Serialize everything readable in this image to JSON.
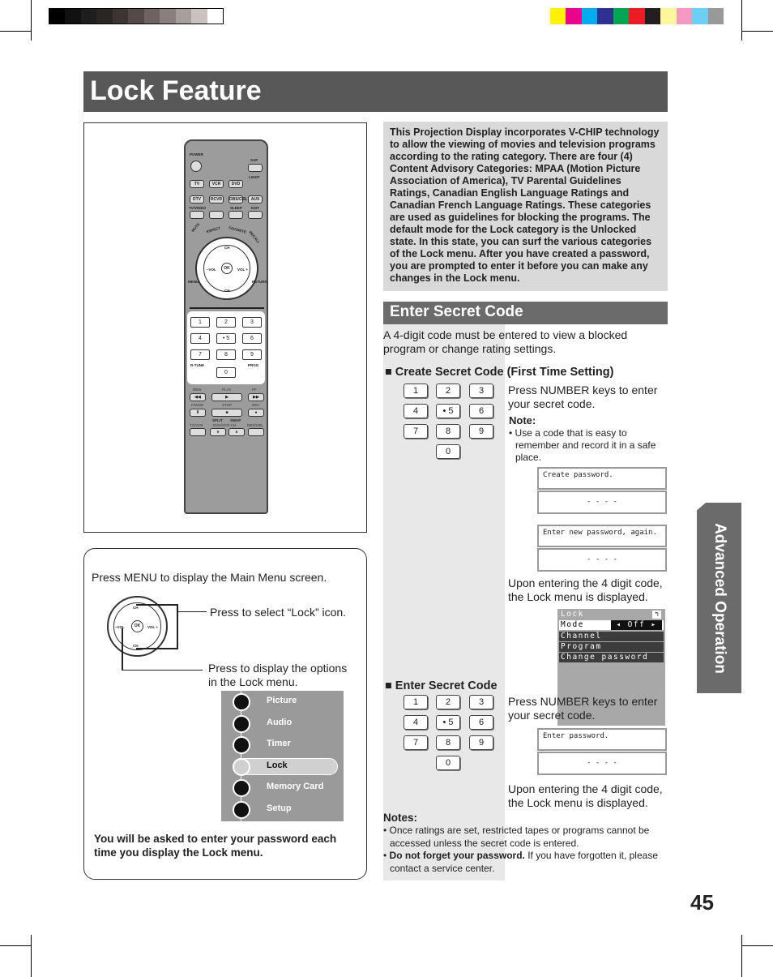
{
  "title": "Lock Feature",
  "page_number": "45",
  "side_tab": "Advanced Operation",
  "intro": "This Projection Display incorporates V-CHIP technology to allow the viewing of movies and television programs according to the rating category. There are four (4) Content Advisory Categories: MPAA (Motion Picture Association of America), TV Parental Guidelines Ratings, Canadian English Language Ratings and Canadian French Language Ratings. These categories are used as guidelines for blocking the programs. The default mode for the Lock category is the Unlocked state. In this state, you can surf the various categories of the Lock menu. After you have created a password, you are prompted to enter it before you can make any changes in the Lock menu.",
  "remote": {
    "top_labels": {
      "power": "POWER",
      "sap": "SAP",
      "light": "LIGHT",
      "tvvideo": "TV/VIDEO",
      "sleep": "SLEEP",
      "exit": "EXIT",
      "menu": "MENU",
      "return": "RETURN",
      "rtune": "R-TUNE",
      "prog": "PROG",
      "rew": "REW",
      "play": "PLAY",
      "ff": "FF",
      "pause": "PAUSE",
      "stop": "STOP",
      "rec": "REC",
      "split": "SPLIT",
      "swap": "SWAP",
      "tvvcr": "TV/VCR",
      "dvdvcrch": "DVD/VCR CH",
      "dbscbl": "DBS/CBL",
      "ch": "CH",
      "vol_minus": "–VOL",
      "vol_plus": "VOL +",
      "ok": "OK"
    },
    "buttons": [
      "TV",
      "VCR",
      "DVD",
      "DTV",
      "RCVR",
      "DBS/CBL",
      "AUX"
    ],
    "arc": [
      "MUTE",
      "ASPECT",
      "FAVORITE",
      "RECALL"
    ],
    "keys": [
      "1",
      "2",
      "3",
      "4",
      "• 5",
      "6",
      "7",
      "8",
      "9",
      "0"
    ]
  },
  "steps": {
    "menu": "Press MENU to display the Main Menu screen.",
    "select": "Press to select “Lock” icon.",
    "display": "Press to display the options in the Lock menu.",
    "warning": "You will be asked to enter your password each time you display the Lock menu."
  },
  "main_menu": [
    {
      "label": "Picture",
      "icon": "tv-icon"
    },
    {
      "label": "Audio",
      "icon": "music-note-icon"
    },
    {
      "label": "Timer",
      "icon": "power-timer-icon"
    },
    {
      "label": "Lock",
      "icon": "lock-icon",
      "selected": true
    },
    {
      "label": "Memory Card",
      "icon": "memory-card-icon"
    },
    {
      "label": "Setup",
      "icon": "setup-icon"
    }
  ],
  "section": {
    "title": "Enter Secret Code",
    "desc": "A 4-digit code must be entered to view a blocked program or change rating settings.",
    "create_title": "Create Secret Code (First Time Setting)",
    "press_keys": "Press NUMBER keys to enter your secret code.",
    "note_label": "Note:",
    "note": "• Use a code that is easy to remember and record it in a safe place.",
    "osd_create": "Create password.",
    "osd_again": "Enter new password, again.",
    "osd_enter": "Enter password.",
    "dashes": "- - - -",
    "upon": "Upon entering the 4 digit code, the Lock menu is displayed.",
    "enter_title": "Enter Secret Code",
    "notes_label": "Notes:",
    "notes1": "• Once ratings are set, restricted tapes or programs cannot be accessed unless the secret code is entered.",
    "notes2_bold": "Do not forget your password.",
    "notes2": " If you have forgotten it, please contact a service center."
  },
  "lock_menu": {
    "title": "Lock",
    "mode": "Mode",
    "mode_value": "Off",
    "items": [
      "Channel",
      "Program",
      "Change password"
    ]
  }
}
